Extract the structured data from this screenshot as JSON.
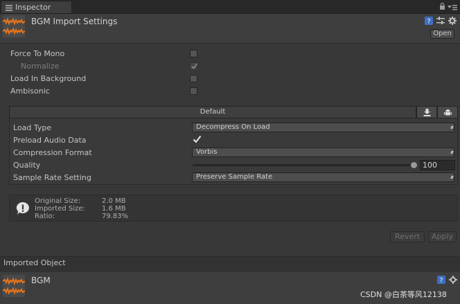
{
  "tab": {
    "title": "Inspector",
    "icon": "inspector-icon"
  },
  "header": {
    "title": "BGM Import Settings",
    "open_label": "Open",
    "icons": [
      "help-icon",
      "preset-icon",
      "gear-icon"
    ]
  },
  "options": [
    {
      "label": "Force To Mono",
      "checked": false
    },
    {
      "label": "Normalize",
      "checked": true,
      "disabled": true
    },
    {
      "label": "Load In Background",
      "checked": false
    },
    {
      "label": "Ambisonic",
      "checked": false
    }
  ],
  "platform": {
    "default_label": "Default",
    "tabs": [
      "download-icon",
      "android-icon"
    ]
  },
  "settings": {
    "load_type": {
      "label": "Load Type",
      "value": "Decompress On Load"
    },
    "preload": {
      "label": "Preload Audio Data",
      "checked": true
    },
    "compression": {
      "label": "Compression Format",
      "value": "Vorbis"
    },
    "quality": {
      "label": "Quality",
      "value": "100",
      "level": 1.0
    },
    "sample_rate": {
      "label": "Sample Rate Setting",
      "value": "Preserve Sample Rate"
    }
  },
  "info": {
    "rows": [
      {
        "key": "Original Size:",
        "value": "2.0 MB"
      },
      {
        "key": "Imported Size:",
        "value": "1.6 MB"
      },
      {
        "key": "Ratio:",
        "value": "79.83%"
      }
    ]
  },
  "buttons": {
    "revert": "Revert",
    "apply": "Apply"
  },
  "imported": {
    "section_title": "Imported Object",
    "name": "BGM"
  },
  "watermark": "CSDN @白茶等风12138",
  "colors": {
    "accent": "#e8761c",
    "panel": "#383838"
  }
}
